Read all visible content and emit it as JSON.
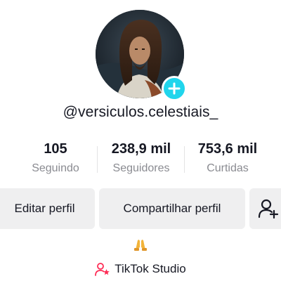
{
  "profile": {
    "username": "@versiculos.celestiais_"
  },
  "stats": {
    "following": {
      "value": "105",
      "label": "Seguindo"
    },
    "followers": {
      "value": "238,9 mil",
      "label": "Seguidores"
    },
    "likes": {
      "value": "753,6 mil",
      "label": "Curtidas"
    }
  },
  "actions": {
    "edit_label": "Editar perfil",
    "share_label": "Compartilhar perfil",
    "add_friend_icon": "person-add-icon"
  },
  "bio": {
    "emoji_icon": "praying-hands-icon"
  },
  "studio": {
    "label": "TikTok Studio",
    "icon": "person-star-icon"
  },
  "colors": {
    "accent": "#20d5ec",
    "studio_icon": "#fe2c55",
    "muted_text": "#8a8b91",
    "button_bg": "#efeff0"
  }
}
